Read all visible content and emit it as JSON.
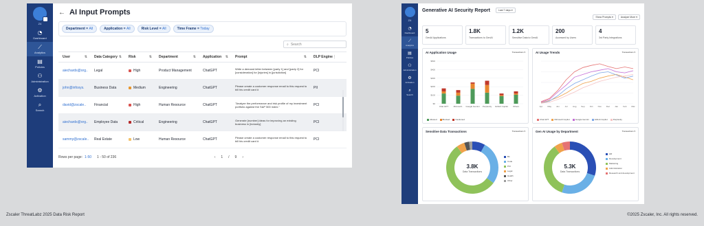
{
  "left": {
    "sidebar": {
      "org": "Z4",
      "items": [
        {
          "icon": "◔",
          "label": "Dashboard"
        },
        {
          "icon": "⟋",
          "label": "Analytics",
          "active": true
        },
        {
          "icon": "▤",
          "label": "Policies"
        },
        {
          "icon": "⚇",
          "label": "Administration"
        },
        {
          "icon": "⚙",
          "label": "Activation"
        },
        {
          "icon": "⌕",
          "label": "Search"
        }
      ]
    },
    "title": "AI Input Prompts",
    "filters": [
      {
        "key": "Department",
        "value": "All"
      },
      {
        "key": "Application",
        "value": "All"
      },
      {
        "key": "Risk Level",
        "value": "All"
      },
      {
        "key": "Time Frame",
        "value": "Today"
      }
    ],
    "search_placeholder": "Search",
    "columns": [
      "User",
      "Data Category",
      "Risk",
      "Department",
      "Application",
      "Prompt",
      "DLP Engine"
    ],
    "rows": [
      {
        "user": "aiechards@org..",
        "category": "Legal",
        "risk": "High",
        "risk_color": "#d9534f",
        "department": "Product Management",
        "app": "ChatGPT",
        "prompt": "Write a demand letter between [party 1] and [party 2] for [consideration] for [injuries] in [jurisdiction]",
        "dlp": "PCI"
      },
      {
        "user": "john@infosys.",
        "category": "Business Data",
        "risk": "Medium",
        "risk_color": "#e8962e",
        "department": "Engineering",
        "app": "ChatGPT",
        "prompt": "Please create a customer response email to this request to bill his credit card #",
        "dlp": "PII"
      },
      {
        "user": "david@zscale..",
        "category": "Financial",
        "risk": "High",
        "risk_color": "#d9534f",
        "department": "Human Resource",
        "app": "ChatGPT",
        "prompt": "\"Analyze the performance and risk profile of my investment portfolio against the S&P 500 index.\"",
        "dlp": "PCI"
      },
      {
        "user": "aiechards@org..",
        "category": "Employee Data",
        "risk": "Critical",
        "risk_color": "#b52a2a",
        "department": "Engineering",
        "app": "ChatGPT",
        "prompt": "Generate [number] ideas for improving an existing business in [industry]",
        "dlp": "PCI"
      },
      {
        "user": "sammy@zscale..",
        "category": "Real Estate",
        "risk": "Low",
        "risk_color": "#f3c26b",
        "department": "Human Resource",
        "app": "ChatGPT",
        "prompt": "Please create a customer response email to this request to bill his credit card #",
        "dlp": "PCI"
      }
    ],
    "pager": {
      "rows_label": "Rows per page:",
      "rows_value": "1-50",
      "range": "1 - 50 of 236",
      "current": "1",
      "sep": "/",
      "total": "9",
      "prev": "‹",
      "next": "›"
    }
  },
  "right": {
    "sidebar": {
      "org": "Z4",
      "items": [
        {
          "icon": "◔",
          "label": "Dashboard"
        },
        {
          "icon": "⟋",
          "label": "Analytics",
          "active": true
        },
        {
          "icon": "▤",
          "label": "Policies"
        },
        {
          "icon": "⚇",
          "label": "Administration"
        },
        {
          "icon": "⚙",
          "label": "Activation"
        },
        {
          "icon": "⌕",
          "label": "Search"
        }
      ]
    },
    "title": "Generative AI Security Report",
    "timeframe": "Last 7 days",
    "buttons": [
      "Show Prompts",
      "Analyze More"
    ],
    "kpis": [
      {
        "value": "5",
        "label": "GenAI Applications"
      },
      {
        "value": "1.8K",
        "label": "Transactions to GenAI"
      },
      {
        "value": "1.2K",
        "label": "Sensitive Data to GenAI"
      },
      {
        "value": "200",
        "label": "Accessed by Users"
      },
      {
        "value": "4",
        "label": "3rd Party Integrations"
      }
    ],
    "panels": {
      "usage": {
        "title": "AI Application Usage",
        "dropdown": "Transactions"
      },
      "trends": {
        "title": "AI Usage Trends",
        "dropdown": "Transactions"
      },
      "sensitive": {
        "title": "Sensitive Data Transactions",
        "dropdown": "Transactions",
        "center_value": "3.8K",
        "center_label": "Data Transactions"
      },
      "dept": {
        "title": "Gen AI Usage by Department",
        "dropdown": "Transactions",
        "center_value": "5.3K",
        "center_label": "Data Transactions"
      }
    }
  },
  "chart_data": [
    {
      "type": "bar",
      "title": "AI Application Usage",
      "categories": [
        "Chat GPT",
        "Microsoft..",
        "Google Gemini",
        "Perplexity",
        "Github Copilot",
        "Others"
      ],
      "series": [
        {
          "name": "Allowed",
          "color": "#4e9a5a",
          "values": [
            120,
            95,
            175,
            130,
            90,
            105
          ]
        },
        {
          "name": "Blocked",
          "color": "#e8862e",
          "values": [
            25,
            35,
            60,
            90,
            10,
            15
          ]
        },
        {
          "name": "Cautioned",
          "color": "#c0392b",
          "values": [
            35,
            30,
            15,
            50,
            20,
            25
          ]
        }
      ],
      "ylim": [
        0,
        500
      ],
      "yticks": [
        "$0",
        "$100",
        "$200",
        "$300",
        "$400",
        "$500"
      ]
    },
    {
      "type": "line",
      "title": "AI Usage Trends",
      "categories": [
        "Apr",
        "May",
        "Jun",
        "Jul",
        "Aug",
        "Sep",
        "Oct",
        "Nov",
        "Dec",
        "Jan",
        "Feb",
        "Mar"
      ],
      "series": [
        {
          "name": "Chat GPT",
          "color": "#e57373",
          "values": [
            4,
            10,
            25,
            45,
            60,
            68,
            72,
            75,
            70,
            66,
            69,
            66
          ]
        },
        {
          "name": "Microsoft Copilot",
          "color": "#f0a24b",
          "values": [
            2,
            6,
            12,
            20,
            30,
            38,
            42,
            48,
            52,
            55,
            50,
            45
          ]
        },
        {
          "name": "Google Gemini",
          "color": "#c46cd6",
          "values": [
            3,
            8,
            22,
            35,
            50,
            55,
            60,
            63,
            66,
            60,
            58,
            62
          ]
        },
        {
          "name": "Github Copilot",
          "color": "#7fa8e8",
          "values": [
            1,
            5,
            15,
            28,
            38,
            45,
            52,
            58,
            60,
            54,
            48,
            52
          ]
        },
        {
          "name": "Perplexity",
          "color": "#f6c3c3",
          "values": [
            1,
            3,
            8,
            15,
            22,
            30,
            36,
            42,
            46,
            50,
            52,
            55
          ]
        }
      ],
      "ylim": [
        0,
        80
      ]
    },
    {
      "type": "pie",
      "title": "Sensitive Data Transactions",
      "labels": [
        "Bit",
        "Code",
        "PCI",
        "Legal",
        "Health",
        "Other"
      ],
      "colors": [
        "#2a4fb5",
        "#6ab0e6",
        "#8fc25a",
        "#f0a24b",
        "#555555",
        "#9e9e9e"
      ],
      "values": [
        8,
        27,
        55,
        5,
        3,
        2
      ]
    },
    {
      "type": "pie",
      "title": "Gen AI Usage by Department",
      "labels": [
        "HR",
        "Development",
        "Marketing",
        "Administration",
        "Research and development"
      ],
      "colors": [
        "#2a4fb5",
        "#6ab0e6",
        "#8fc25a",
        "#f0a24b",
        "#e57373"
      ],
      "values": [
        30,
        25,
        35,
        5,
        5
      ]
    }
  ],
  "footer": {
    "left": "Zscaler ThreatLabz 2025 Data Risk Report",
    "right": "©2025 Zscaler, Inc. All rights reserved."
  }
}
